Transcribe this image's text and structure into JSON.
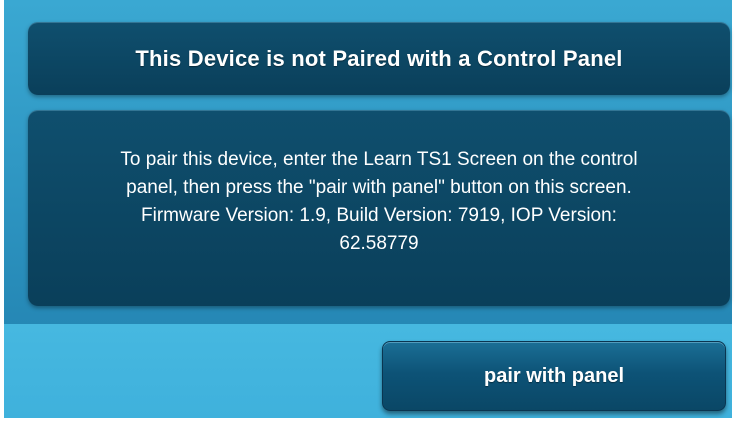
{
  "title_panel": {
    "title": "This Device is not Paired with a Control Panel"
  },
  "info_panel": {
    "lines": [
      "To pair this device, enter the Learn TS1 Screen on the control",
      "panel, then press the \"pair with panel\" button on this screen.",
      "Firmware Version: 1.9, Build Version: 7919, IOP Version:",
      "62.58779"
    ]
  },
  "actions": {
    "pair_button_label": "pair with panel"
  },
  "colors": {
    "background_blue": "#2a8fbc",
    "panel_navy": "#0a3f5a",
    "lower_band_blue": "#3fb1dc",
    "text": "#ffffff"
  }
}
